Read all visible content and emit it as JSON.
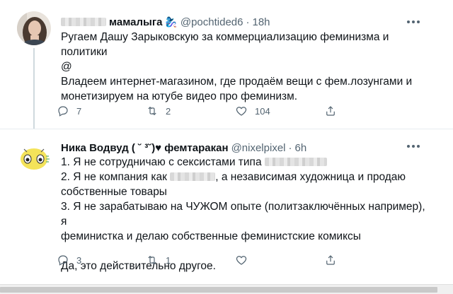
{
  "tweets": [
    {
      "display_name": "мамалыга",
      "emoji": "🧞‍♀️",
      "handle": "@pochtided6",
      "separator": "·",
      "time": "18h",
      "lines": [
        "Ругаем Дашу Зарыковскую за коммерциализацию феминизма и",
        "политики",
        "@",
        "Владеем интернет-магазином, где продаём вещи с фем.лозунгами и",
        "монетизируем на ютубе видео про феминизм."
      ],
      "replies": "7",
      "retweets": "2",
      "likes": "104"
    },
    {
      "display_name": "Ника Водвуд ( ˘ ³˘)♥ фемтаракан",
      "handle": "@nixelpixel",
      "separator": "·",
      "time": "6h",
      "lines": [
        "1. Я не сотрудничаю с сексистами типа",
        "2. Я не компания как",
        ", а независимая художница и продаю",
        "собственные товары",
        "3. Я не зарабатываю на ЧУЖОМ опыте (политзаключённых например), я",
        "феминистка и делаю собственные феминистские комиксы",
        "Да, это действительно другое."
      ],
      "replies": "3",
      "retweets": "1",
      "likes": ""
    }
  ],
  "icons": {
    "reply": "reply-icon",
    "retweet": "retweet-icon",
    "like": "heart-icon",
    "share": "share-icon",
    "more": "more-icon"
  },
  "colors": {
    "text": "#0f1419",
    "secondary": "#536471",
    "divider": "#e6ecf0",
    "thread_line": "#cfd9de"
  }
}
